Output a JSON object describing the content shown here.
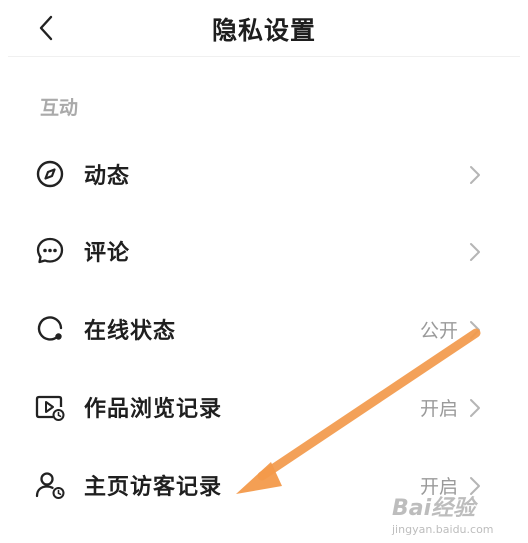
{
  "header": {
    "title": "隐私设置"
  },
  "section": {
    "title": "互动"
  },
  "rows": [
    {
      "label": "动态",
      "value": "",
      "icon": "compass-icon"
    },
    {
      "label": "评论",
      "value": "",
      "icon": "comment-bubble-icon"
    },
    {
      "label": "在线状态",
      "value": "公开",
      "icon": "online-status-icon"
    },
    {
      "label": "作品浏览记录",
      "value": "开启",
      "icon": "video-history-icon"
    },
    {
      "label": "主页访客记录",
      "value": "开启",
      "icon": "visitor-history-icon"
    }
  ],
  "annotation": {
    "color": "#f39a4b"
  },
  "watermark": {
    "logo": "Bai经验",
    "url": "jingyan.baidu.com"
  }
}
